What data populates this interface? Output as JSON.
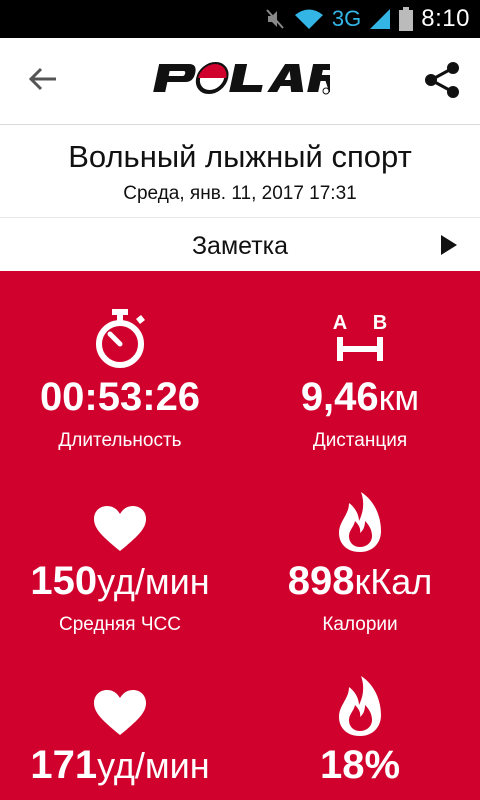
{
  "status_bar": {
    "network": "3G",
    "time": "8:10"
  },
  "app_bar": {
    "logo_text": "POLAR"
  },
  "session": {
    "title": "Вольный лыжный спорт",
    "datetime": "Среда, янв. 11, 2017 17:31"
  },
  "note": {
    "label": "Заметка"
  },
  "colors": {
    "accent": "#d0022d"
  },
  "stats": [
    {
      "icon": "stopwatch-icon",
      "value": "00:53:26",
      "unit": "",
      "label": "Длительность"
    },
    {
      "icon": "distance-ab-icon",
      "icon_text_a": "A",
      "icon_text_b": "B",
      "value": "9,46",
      "unit": "км",
      "label": "Дистанция"
    },
    {
      "icon": "heart-icon",
      "value": "150",
      "unit": "уд/мин",
      "label": "Средняя ЧСС"
    },
    {
      "icon": "flame-icon",
      "value": "898",
      "unit": "кКал",
      "label": "Калории"
    },
    {
      "icon": "heart-icon",
      "value": "171",
      "unit": "уд/мин",
      "label": ""
    },
    {
      "icon": "flame-icon",
      "value": "18%",
      "unit": "",
      "label": ""
    }
  ]
}
